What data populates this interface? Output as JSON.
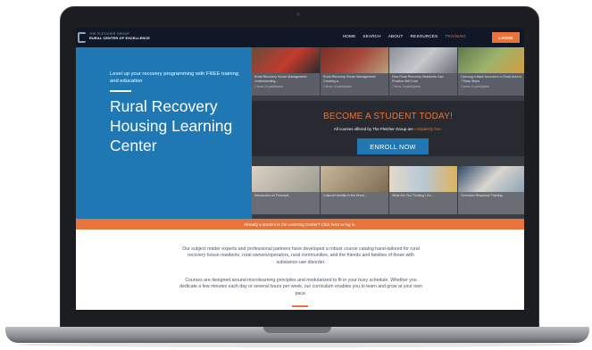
{
  "nav": {
    "brand_line1": "THE FLETCHER GROUP",
    "brand_line2": "RURAL CENTER OF EXCELLENCE",
    "items": [
      {
        "label": "HOME",
        "active": false
      },
      {
        "label": "SEARCH",
        "active": false
      },
      {
        "label": "ABOUT",
        "active": false
      },
      {
        "label": "RESOURCES",
        "active": false
      },
      {
        "label": "TRAINING",
        "active": true
      }
    ],
    "login_label": "LOGIN"
  },
  "hero": {
    "tagline": "Level up your recovery programming with FREE training and education",
    "title": "Rural Recovery Housing Learning Center",
    "cta_title": "BECOME A STUDENT TODAY!",
    "cta_sub_prefix": "All courses offered by The Fletcher Group are",
    "cta_sub_highlight": "completely free.",
    "enroll_label": "ENROLL NOW",
    "top_tiles": [
      {
        "caption": "Rural Recovery House Management: Understanding...",
        "meta": "1 items   10 participants"
      },
      {
        "caption": "Rural Recovery House Management: Creating a...",
        "meta": "1 items   10 participants"
      },
      {
        "caption": "How Rural Recovery Residents Can Practice Self Care",
        "meta": "7 items   10 participants"
      },
      {
        "caption": "Opening a Bank Account in a Rural Area in 7 Easy Steps",
        "meta": "1 items   10 participants"
      }
    ],
    "bottom_tiles": [
      {
        "caption": "Introduction to Financial..."
      },
      {
        "caption": "Cultural Humility in the Rural..."
      },
      {
        "caption": "What Are You Thinking? An..."
      },
      {
        "caption": "Overdose Response Training"
      }
    ]
  },
  "banner": {
    "text": "Already a student in the Learning Center? Click here to log in."
  },
  "body": {
    "para1": "Our subject matter experts and professional partners have developed a robust course catalog hand-tailored for rural recovery house residents, rural owners/operators, rural communities, and the friends and families of those with substance-use disorder.",
    "para2": "Courses are designed around microlearning principles and modularized to fit in your busy schedule. Whether you dedicate a few minutes each day or several hours per week, our curriculum enables you to learn and grow at your own pace."
  },
  "colors": {
    "nav_bg": "#101828",
    "accent": "#e8743b",
    "primary": "#1f77b4"
  }
}
